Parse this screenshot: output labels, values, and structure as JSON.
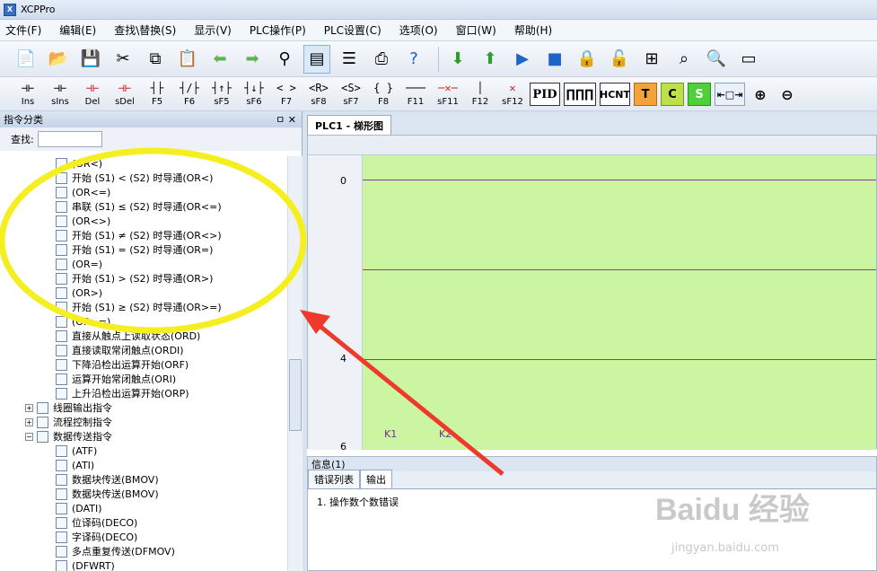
{
  "window": {
    "title": "XCPPro"
  },
  "menu": [
    "文件(F)",
    "编辑(E)",
    "查找\\替换(S)",
    "显示(V)",
    "PLC操作(P)",
    "PLC设置(C)",
    "选项(O)",
    "窗口(W)",
    "帮助(H)"
  ],
  "ladder_toolbar": [
    {
      "sym": "⊣⊢",
      "label": "Ins"
    },
    {
      "sym": "⊣⊢",
      "label": "sIns"
    },
    {
      "sym": "⊣⊢",
      "label": "Del"
    },
    {
      "sym": "⊣⊢",
      "label": "sDel"
    },
    {
      "sym": "┤├",
      "label": "F5"
    },
    {
      "sym": "┤/├",
      "label": "F6"
    },
    {
      "sym": "┤↑├",
      "label": "sF5"
    },
    {
      "sym": "┤↓├",
      "label": "sF6"
    },
    {
      "sym": "< >",
      "label": "F7"
    },
    {
      "sym": "<R>",
      "label": "sF8"
    },
    {
      "sym": "<S>",
      "label": "sF7"
    },
    {
      "sym": "{ }",
      "label": "F8"
    },
    {
      "sym": "───",
      "label": "F11"
    },
    {
      "sym": "─✕─",
      "label": "sF11"
    },
    {
      "sym": "│",
      "label": "F12"
    },
    {
      "sym": "✕",
      "label": "sF12"
    }
  ],
  "func_buttons": {
    "pid": "PID",
    "pulse": "∏∏∏",
    "hcnt": "HCNT",
    "t": "T",
    "c": "C",
    "s": "S"
  },
  "left_panel": {
    "title": "指令分类",
    "pin": "ㅁ ✕",
    "search_label": "查找:",
    "search_value": "",
    "tree": [
      "(OR<)",
      "开始 (S1) < (S2) 时导通(OR<)",
      "(OR<=)",
      "串联 (S1) ≤ (S2) 时导通(OR<=)",
      "(OR<>)",
      "开始 (S1) ≠ (S2) 时导通(OR<>)",
      "开始 (S1) = (S2) 时导通(OR=)",
      "(OR=)",
      "开始 (S1) > (S2) 时导通(OR>)",
      "(OR>)",
      "开始 (S1) ≥ (S2) 时导通(OR>=)",
      "(OR>=)",
      "直接从触点上读取状态(ORD)",
      "直接读取常闭触点(ORDI)",
      "下降沿检出运算开始(ORF)",
      "运算开始常闭触点(ORI)",
      "上升沿检出运算开始(ORP)"
    ],
    "categories": [
      "线圈输出指令",
      "流程控制指令",
      "数据传送指令"
    ],
    "subitems": [
      "(ATF)",
      "(ATI)",
      "数据块传送(BMOV)",
      "数据块传送(BMOV)",
      "(DATI)",
      "位译码(DECO)",
      "字译码(DECO)",
      "多点重复传送(DFMOV)",
      "(DFWRT)"
    ]
  },
  "editor": {
    "tab": "PLC1 - 梯形图",
    "rows": [
      "0",
      "4",
      "6"
    ],
    "contacts": [
      "K1",
      "K2"
    ]
  },
  "messages": {
    "header": "信息(1)",
    "tabs": [
      "错误列表",
      "输出"
    ],
    "lines": [
      "1. 操作数个数错误"
    ]
  },
  "watermark": {
    "brand": "Baidu 经验",
    "url": "jingyan.baidu.com"
  }
}
